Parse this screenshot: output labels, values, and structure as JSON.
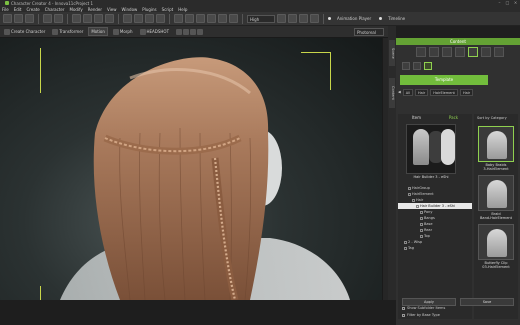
{
  "window": {
    "title": "Character Creator 4 - Innova11cProject 1"
  },
  "menu": [
    "File",
    "Edit",
    "Create",
    "Character",
    "Modify",
    "Render",
    "View",
    "Window",
    "Plugins",
    "Script",
    "Help"
  ],
  "toolbar1": {
    "quality_select": "High",
    "animation_player_label": "Animation Player",
    "timeline_label": "Timeline"
  },
  "toolbar2": {
    "create_character": "Create Character",
    "transformer": "Transformer",
    "model_toggle": "Motion",
    "morph_label": "Morph",
    "headshot_label": "HEADSHOT",
    "render_select": "Photoreal"
  },
  "sidetabs": {
    "scene": "Scene",
    "content": "Content"
  },
  "panel": {
    "header": "Content",
    "template_button": "Template",
    "breadcrumbs": [
      "All",
      "Hair",
      "HairElement",
      "Hair"
    ],
    "col_item": "Item",
    "col_pack": "Pack",
    "preview_label": "Hair Builder 3 - eShi",
    "sort_label": "Sort by Category",
    "tree": [
      {
        "label": "HairGroup",
        "selected": false
      },
      {
        "label": "HairElement",
        "selected": false
      },
      {
        "label": "Hair",
        "selected": false
      },
      {
        "label": "Hair Builder 3 - eShi",
        "selected": true
      },
      {
        "label": "Pony",
        "selected": false
      },
      {
        "label": "Bangs",
        "selected": false
      },
      {
        "label": "Base",
        "selected": false
      },
      {
        "label": "Rear",
        "selected": false
      },
      {
        "label": "Top",
        "selected": false
      },
      {
        "label": "2 - Wisp",
        "selected": false
      },
      {
        "label": "Tag",
        "selected": false
      }
    ],
    "show_subfolder": "Show Subfolder Items",
    "filter_base": "Filter by Base Type",
    "items": [
      {
        "label": "Baby Braids\n3-HairElement"
      },
      {
        "label": "Braid\nBand-HairElement"
      },
      {
        "label": "Butterfly Clip\n03-HairElement"
      }
    ],
    "apply_button": "Apply",
    "save_button": "Save"
  }
}
